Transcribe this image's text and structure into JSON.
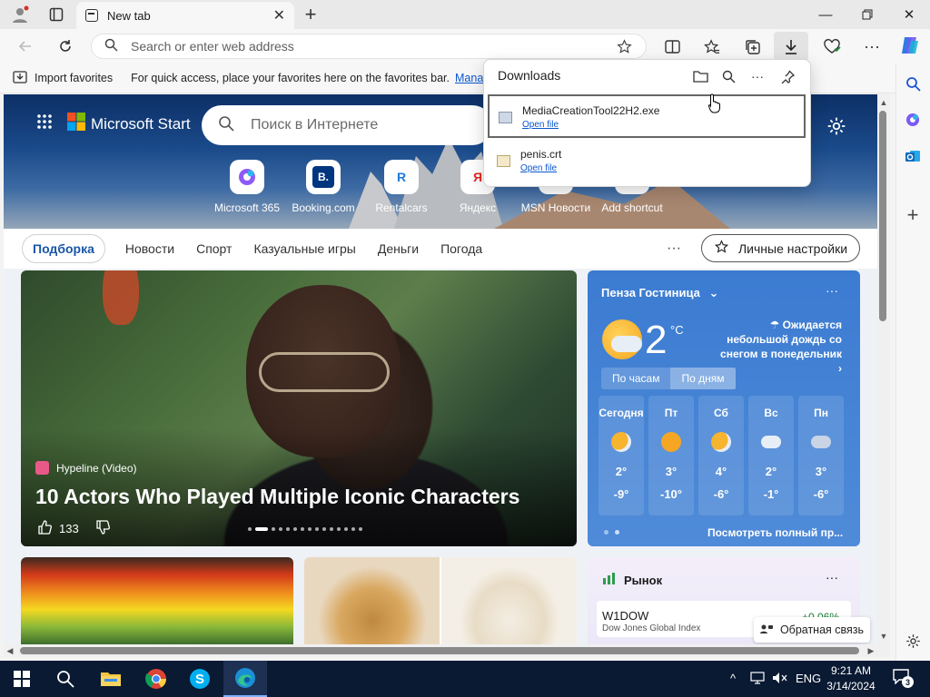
{
  "browser": {
    "tab_title": "New tab",
    "address_placeholder": "Search or enter web address"
  },
  "favorites_bar": {
    "import_label": "Import favorites",
    "message": "For quick access, place your favorites here on the favorites bar.",
    "manage_link": "Manage"
  },
  "downloads": {
    "title": "Downloads",
    "items": [
      {
        "name": "MediaCreationTool22H2.exe",
        "action": "Open file"
      },
      {
        "name": "penis.crt",
        "action": "Open file"
      }
    ]
  },
  "page": {
    "brand": "Microsoft Start",
    "search_placeholder": "Поиск в Интернете",
    "quick_links": [
      {
        "label": "Microsoft 365",
        "glyph": ""
      },
      {
        "label": "Booking.com",
        "glyph": "B."
      },
      {
        "label": "Rentalcars",
        "glyph": "R"
      },
      {
        "label": "Яндекс",
        "glyph": "Я"
      },
      {
        "label": "MSN Новости",
        "glyph": ""
      },
      {
        "label": "Add shortcut",
        "glyph": ""
      }
    ],
    "nav_tabs": [
      "Подборка",
      "Новости",
      "Спорт",
      "Казуальные игры",
      "Деньги",
      "Погода"
    ],
    "personal_settings": "Личные настройки"
  },
  "article": {
    "source": "Hypeline (Video)",
    "headline": "10 Actors Who Played Multiple Iconic Characters",
    "likes": "133"
  },
  "weather": {
    "location": "Пенза Гостиница",
    "temp": "2",
    "unit": "°C",
    "forecast": "Ожидается небольшой дождь со снегом в понедельник",
    "toggle": [
      "По часам",
      "По дням"
    ],
    "days": [
      {
        "name": "Сегодня",
        "hi": "2°",
        "lo": "-9°",
        "icon": "sun-cloud-icon"
      },
      {
        "name": "Пт",
        "hi": "3°",
        "lo": "-10°",
        "icon": "sun-icon"
      },
      {
        "name": "Сб",
        "hi": "4°",
        "lo": "-6°",
        "icon": "sun-cloud-icon"
      },
      {
        "name": "Вс",
        "hi": "2°",
        "lo": "-1°",
        "icon": "cloud-icon"
      },
      {
        "name": "Пн",
        "hi": "3°",
        "lo": "-6°",
        "icon": "rain-snow-icon"
      }
    ],
    "full_forecast": "Посмотреть полный пр..."
  },
  "market": {
    "title": "Рынок",
    "symbol": "W1DOW",
    "name": "Dow Jones Global Index",
    "change": "+0.06%"
  },
  "feedback": "Обратная связь",
  "taskbar": {
    "lang": "ENG",
    "time": "9:21 AM",
    "date": "3/14/2024",
    "notifications": "3"
  },
  "colors": {
    "accent": "#0b57d0",
    "weather_bg": "#3b7bd1",
    "taskbar": "#0a1a33"
  }
}
